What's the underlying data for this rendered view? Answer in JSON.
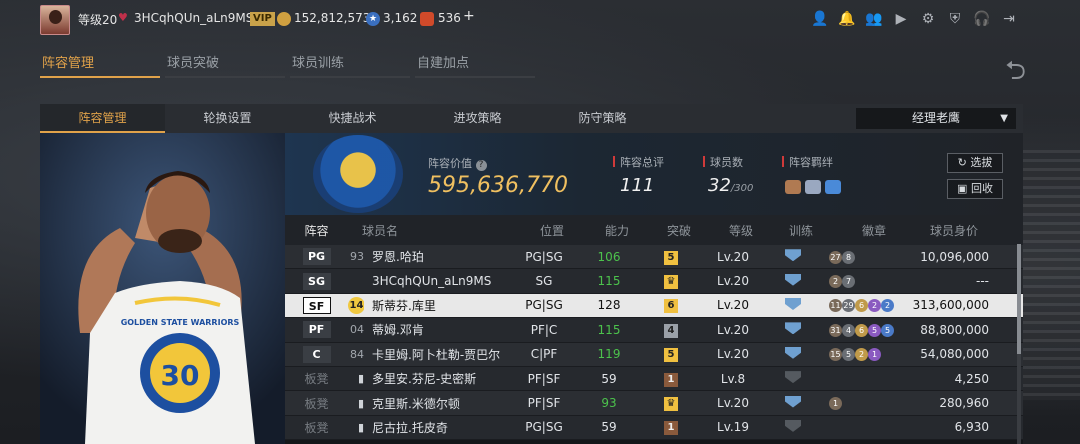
{
  "topbar": {
    "level": "等级20",
    "username": "3HCqhQUn_aLn9MS",
    "vip": "VIP",
    "coins": "152,812,573",
    "stars": "3,162",
    "tickets": "536",
    "add": "+"
  },
  "main_tabs": [
    "阵容管理",
    "球员突破",
    "球员训练",
    "自建加点"
  ],
  "sub_tabs": [
    "阵容管理",
    "轮换设置",
    "快捷战术",
    "进攻策略",
    "防守策略"
  ],
  "dropdown": "经理老鹰",
  "summary": {
    "value_label": "阵容价值",
    "value": "595,636,770",
    "rating_label": "阵容总评",
    "rating": "111",
    "count_label": "球员数",
    "count": "32",
    "count_max": "/300",
    "bond_label": "阵容羁绊",
    "btn_select": "选拔",
    "btn_recycle": "回收"
  },
  "table": {
    "headers": [
      "阵容",
      "球员名",
      "位置",
      "能力",
      "突破",
      "等级",
      "训练",
      "徽章",
      "球员身价"
    ],
    "rows": [
      {
        "slot": "PG",
        "num": "93",
        "name": "罗恩.哈珀",
        "pos": "PG|SG",
        "ability": "106",
        "green": true,
        "brk": "5",
        "brk_type": "gold",
        "lv": "Lv.20",
        "train": "blue",
        "badges": [
          "27",
          "8"
        ],
        "value": "10,096,000"
      },
      {
        "slot": "SG",
        "num": "",
        "name": "3HCqhQUn_aLn9MS",
        "pos": "SG",
        "ability": "115",
        "green": true,
        "brk": "♛",
        "brk_type": "gold",
        "lv": "Lv.20",
        "train": "blue",
        "badges": [
          "2",
          "7"
        ],
        "value": "---"
      },
      {
        "slot": "SF",
        "num": "14",
        "name": "斯蒂芬.库里",
        "pos": "PG|SG",
        "ability": "128",
        "green": false,
        "brk": "6",
        "brk_type": "gold",
        "lv": "Lv.20",
        "train": "blue",
        "badges": [
          "11",
          "29",
          "6",
          "2",
          "2"
        ],
        "value": "313,600,000"
      },
      {
        "slot": "PF",
        "num": "04",
        "name": "蒂姆.邓肯",
        "pos": "PF|C",
        "ability": "115",
        "green": true,
        "brk": "4",
        "brk_type": "grey",
        "lv": "Lv.20",
        "train": "blue",
        "badges": [
          "31",
          "4",
          "6",
          "5",
          "5"
        ],
        "value": "88,800,000"
      },
      {
        "slot": "C",
        "num": "84",
        "name": "卡里姆.阿卜杜勒-贾巴尔",
        "pos": "C|PF",
        "ability": "119",
        "green": true,
        "brk": "5",
        "brk_type": "gold",
        "lv": "Lv.20",
        "train": "blue",
        "badges": [
          "15",
          "5",
          "2",
          "1"
        ],
        "value": "54,080,000"
      },
      {
        "slot": "板凳",
        "num": "",
        "name": "多里安.芬尼-史密斯",
        "pos": "PF|SF",
        "ability": "59",
        "green": false,
        "brk": "1",
        "brk_type": "brown",
        "lv": "Lv.8",
        "train": "grey",
        "badges": [],
        "value": "4,250"
      },
      {
        "slot": "板凳",
        "num": "",
        "name": "克里斯.米德尔顿",
        "pos": "PF|SF",
        "ability": "93",
        "green": true,
        "brk": "♛",
        "brk_type": "gold",
        "lv": "Lv.20",
        "train": "blue",
        "badges": [
          "1"
        ],
        "value": "280,960"
      },
      {
        "slot": "板凳",
        "num": "",
        "name": "尼古拉.托皮奇",
        "pos": "PG|SG",
        "ability": "59",
        "green": false,
        "brk": "1",
        "brk_type": "brown",
        "lv": "Lv.19",
        "train": "grey",
        "badges": [],
        "value": "6,930"
      }
    ]
  },
  "jersey_number": "30",
  "jersey_text": "GOLDEN STATE WARRIORS"
}
